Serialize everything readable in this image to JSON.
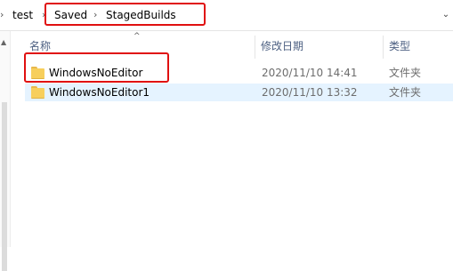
{
  "address_bar": {
    "crumbs": [
      "test",
      "Saved",
      "StagedBuilds"
    ],
    "separator_icon": "chevron-right-icon"
  },
  "columns": {
    "name": "名称",
    "date_modified": "修改日期",
    "type": "类型"
  },
  "files": [
    {
      "name": "WindowsNoEditor",
      "date": "2020/11/10 14:41",
      "type": "文件夹",
      "icon": "folder-icon"
    },
    {
      "name": "WindowsNoEditor1",
      "date": "2020/11/10 13:32",
      "type": "文件夹",
      "icon": "folder-icon"
    }
  ],
  "colors": {
    "highlight_border": "#e01010",
    "selected_row": "#e5f3ff",
    "folder": "#f7cf5c",
    "header_text": "#4d6082"
  }
}
